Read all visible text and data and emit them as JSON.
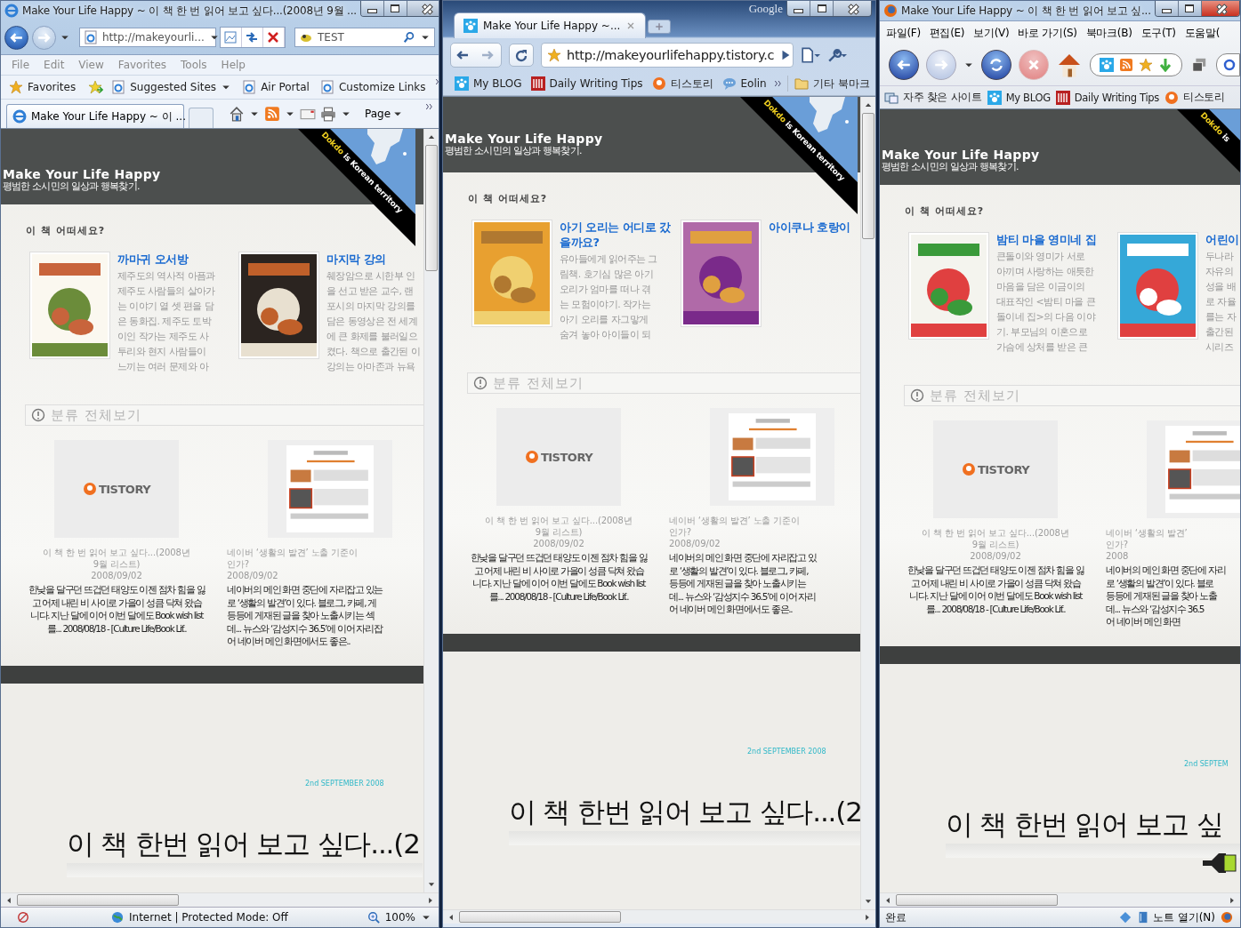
{
  "windows": [
    {
      "kind": "ie",
      "title": "Make Your Life Happy ~ 이 책 한 번 읽어 보고 싶다...(2008년 9월 ...",
      "address": "http://makeyourli...",
      "search": "TEST",
      "menu": [
        "File",
        "Edit",
        "View",
        "Favorites",
        "Tools",
        "Help"
      ],
      "bookmarks": [
        {
          "label": "Favorites",
          "kind": "star"
        },
        {
          "label": "Suggested Sites",
          "kind": "ie-drop"
        },
        {
          "label": "Air Portal",
          "kind": "ie"
        },
        {
          "label": "Customize Links",
          "kind": "ie"
        }
      ],
      "tab": "Make Your Life Happy ~ 이 ...",
      "command": "Page",
      "status": "Internet | Protected Mode: Off",
      "zoom": "100%",
      "page": {
        "title": "Make Your Life Happy",
        "subtitle": "평범한 소시민의 일상과 행복찾기.",
        "ribbon": {
          "highlight": "Dokdo",
          "rest": " is Korean territory"
        },
        "section": "이 책 어떠세요?",
        "books": [
          {
            "title": "까마귀 오서방",
            "lines": [
              "제주도의 역사적 아픔과",
              "제주도 사람들의 살아가",
              "는 이야기 열 셋 편을 담",
              "은 동화집. 제주도 토박",
              "이인 작가는 제주도 사",
              "투리와 현지 사람들이",
              "느끼는 여러 문제와 아"
            ]
          },
          {
            "title": "마지막 강의",
            "lines": [
              "췌장암으로 시한부 인",
              "을 선고 받은 교수, 랜",
              "포시의 마지막 강의를",
              "담은 동영상은 전 세계",
              "에 큰 화제를 불러일으",
              "켰다. 책으로 출간된 이",
              "강의는 아마존과 뉴욕"
            ]
          }
        ],
        "category": "분류 전체보기",
        "posts": [
          {
            "kind": "logo",
            "logo": "TISTORY",
            "title": [
              "이 책 한 번 읽어 보고 싶다...(2008년",
              "9월 리스트)"
            ],
            "date": "2008/09/02",
            "lines": [
              "한낮을 달구던 뜨겁던 태양도 이젠 점차 힘을 잃",
              "고 어제 내린 비 사이로 가을이 성큼 닥쳐 왔습",
              "니다. 지난 달에 이어 이번 달에도 Book wish list",
              "를... 2008/08/18 - [Culture Life/Book Lif.."
            ]
          },
          {
            "kind": "screenshot",
            "title": [
              "네이버 ‘생활의 발견’ 노출 기준이",
              "인가?"
            ],
            "date": "2008/09/02",
            "lines": [
              "네이버의 메인 화면 중단에 자리잡고 있는",
              "로 ‘생활의 발견’이 있다. 블로그, 카페, 게",
              "등등에 게재된 글을 찾아 노출시키는 섹",
              "데... 뉴스와 ‘감성지수 36.5’에 이어 자리잡",
              "어 네이버 메인 화면에서도 좋은.."
            ]
          }
        ],
        "date_line": "2nd SEPTEMBER 2008",
        "headline": "이 책 한번 읽어 보고 싶다...(2"
      }
    },
    {
      "kind": "chrome",
      "brand": "Google",
      "tab": "Make Your Life Happy ~...",
      "address": "http://makeyourlifehappy.tistory.c",
      "bookmarks": [
        {
          "label": "My BLOG",
          "kind": "paw"
        },
        {
          "label": "Daily Writing Tips",
          "kind": "dw"
        },
        {
          "label": "티스토리",
          "kind": "tistory"
        },
        {
          "label": "Eolin",
          "kind": "bubble"
        }
      ],
      "other": "기타 북마크",
      "page": {
        "title": "Make Your Life Happy",
        "subtitle": "평범한 소시민의 일상과 행복찾기.",
        "ribbon": {
          "highlight": "Dokdo",
          "rest": " is Korean territory"
        },
        "section": "이 책 어떠세요?",
        "books": [
          {
            "title": "아기 오리는 어디로 갔을까요?",
            "lines": [
              "유아들에게 읽어주는 그",
              "림책. 호기심 많은 아기",
              "오리가 엄마를 떠나 겪",
              "는 모험이야기. 작가는",
              "아기 오리를 자그맣게",
              "숨겨 놓아 아이들이 되"
            ]
          },
          {
            "title": "아이쿠나 호랑이"
          }
        ],
        "category": "분류 전체보기",
        "posts": [
          {
            "kind": "logo",
            "logo": "TISTORY",
            "title": [
              "이 책 한 번 읽어 보고 싶다...(2008년",
              "9월 리스트)"
            ],
            "date": "2008/09/02",
            "lines": [
              "한낮을 달구던 뜨겁던 태양도 이젠 점차 힘을 잃",
              "고 어제 내린 비 사이로 가을이 성큼 닥쳐 왔습",
              "니다. 지난 달에 이어 이번 달에도 Book wish list",
              "를... 2008/08/18 - [Culture Life/Book Lif.."
            ]
          },
          {
            "kind": "screenshot",
            "title": [
              "네이버 ‘생활의 발견’ 노출 기준이",
              "인가?"
            ],
            "date": "2008/09/02",
            "lines": [
              "네이버의 메인 화면 중단에 자리잡고 있",
              "로 ‘생활의 발견’이 있다. 블로그, 카페,",
              "등등에 게재된 글을 찾아 노출시키는",
              "데... 뉴스와 ‘감성지수 36.5’에 이어 자리",
              "어 네이버 메인 화면에서도 좋은.."
            ]
          }
        ],
        "date_line": "2nd SEPTEMBER 2008",
        "headline": "이 책 한번 읽어 보고 싶다...(2"
      }
    },
    {
      "kind": "firefox",
      "title": "Make Your Life Happy ~ 이 책 한 번 읽어 보고 싶...",
      "menu": [
        "파일(F)",
        "편집(E)",
        "보기(V)",
        "바로 가기(S)",
        "북마크(B)",
        "도구(T)",
        "도움말("
      ],
      "bookmarks": [
        {
          "label": "자주 찾은 사이트",
          "kind": "folder"
        },
        {
          "label": "My BLOG",
          "kind": "paw"
        },
        {
          "label": "Daily Writing Tips",
          "kind": "dw"
        },
        {
          "label": "티스토리",
          "kind": "tistory"
        }
      ],
      "status": "완료",
      "notes": "노트 열기(N)",
      "page": {
        "title": "Make Your Life Happy",
        "subtitle": "평범한 소시민의 일상과 행복찾기.",
        "ribbon": {
          "highlight": "Dokdo",
          "rest": " is"
        },
        "section": "이 책 어떠세요?",
        "books": [
          {
            "title": "밤티 마을 영미네 집",
            "lines": [
              "큰돌이와 영미가 서로",
              "아끼며 사랑하는 애틋한",
              "마음을 담은 이금이의",
              "대표작인 <밤티 마을 큰",
              "돌이네 집>의 다음 이야",
              "기. 부모님의 이혼으로",
              "가슴에 상처를 받은 큰"
            ]
          },
          {
            "title": "어린이",
            "lines": [
              "두나라",
              "자유의",
              "성을 배",
              "로 자율",
              "를는 자",
              "출간된",
              "시리즈"
            ]
          }
        ],
        "category": "분류 전체보기",
        "posts": [
          {
            "kind": "logo",
            "logo": "TISTORY",
            "title": [
              "이 책 한 번 읽어 보고 싶다...(2008년",
              "9월 리스트)"
            ],
            "date": "2008/09/02",
            "lines": [
              "한낮을 달구던 뜨겁던 태양도 이젠 점차 힘을 잃",
              "고 어제 내린 비 사이로 가을이 성큼 닥쳐 왔습",
              "니다. 지난 달에 이어 이번 달에도 Book wish list",
              "를... 2008/08/18 - [Culture Life/Book Lif.."
            ]
          },
          {
            "kind": "screenshot",
            "title": [
              "네이버 ‘생활의 발견’",
              "인가?"
            ],
            "date": "2008",
            "lines": [
              "네이버의 메인 화면 중단에 자리",
              "로 ‘생활의 발견’이 있다. 블로",
              "등등에 게재된 글을 찾아 노출",
              "데... 뉴스와 ‘감성지수 36.5",
              "어 네이버 메인 화면"
            ]
          }
        ],
        "date_line": "2nd SEPTEM",
        "headline": "이 책 한번 읽어 보고 싶"
      }
    }
  ]
}
